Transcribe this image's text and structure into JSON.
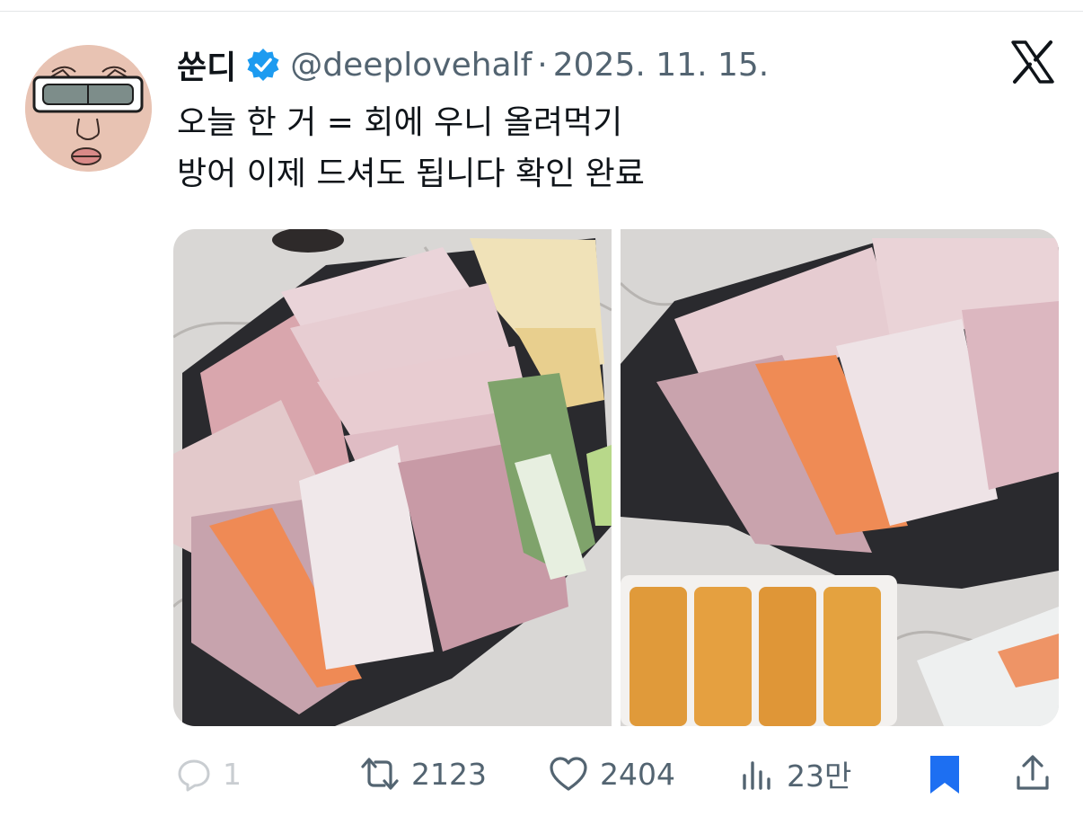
{
  "tweet": {
    "display_name": "쑨디",
    "handle": "@deeplovehalf",
    "separator": "·",
    "date": "2025. 11. 15.",
    "verified": true,
    "text_lines": [
      "오늘 한 거 = 회에 우니 올려먹기",
      "방어 이제 드셔도 됩니다 확인 완료"
    ]
  },
  "media": {
    "photos": [
      {
        "subject": "sashimi platter"
      },
      {
        "subject": "sashimi platter with sea urchin"
      }
    ]
  },
  "actions": {
    "reply_count": "1",
    "retweet_count": "2123",
    "like_count": "2404",
    "view_count": "23만"
  },
  "icons": {
    "reply": "reply-icon",
    "retweet": "retweet-icon",
    "like": "heart-icon",
    "views": "views-icon",
    "bookmark": "bookmark-icon",
    "share": "share-icon",
    "brand": "x-logo-icon",
    "verified": "verified-badge-icon"
  },
  "colors": {
    "text_primary": "#0f1419",
    "text_secondary": "#536471",
    "accent_blue": "#1d9bf0",
    "bookmark_blue": "#1d6ff2",
    "muted_icon": "#c9cdd1"
  }
}
